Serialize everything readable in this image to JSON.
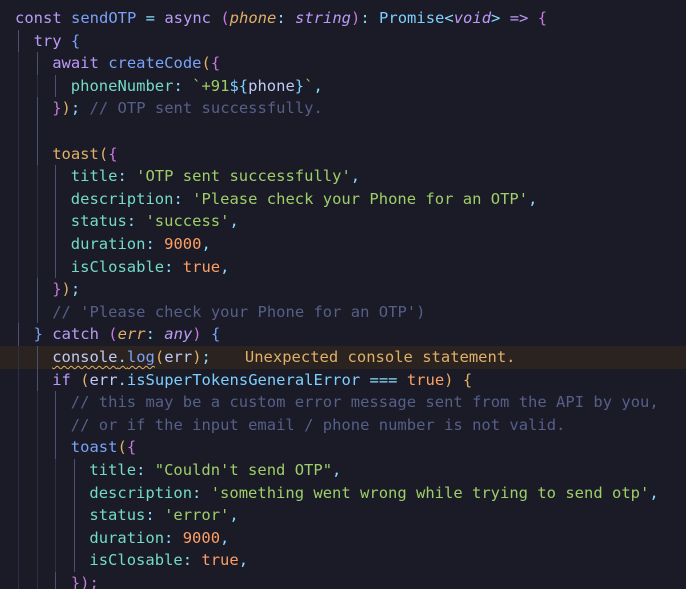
{
  "editor": {
    "lines": [
      {
        "indent": 0,
        "tokens": [
          {
            "t": "const ",
            "c": "#bb9af7"
          },
          {
            "t": "sendOTP",
            "c": "#7aa2f7"
          },
          {
            "t": " = ",
            "c": "#89ddff"
          },
          {
            "t": "async ",
            "c": "#bb9af7"
          },
          {
            "t": "(",
            "c": "#c678dd"
          },
          {
            "t": "phone",
            "c": "#e0af68",
            "i": true
          },
          {
            "t": ": ",
            "c": "#89ddff"
          },
          {
            "t": "string",
            "c": "#bb9af7",
            "i": true
          },
          {
            "t": ")",
            "c": "#c678dd"
          },
          {
            "t": ": ",
            "c": "#89ddff"
          },
          {
            "t": "Promise",
            "c": "#7dcfff"
          },
          {
            "t": "<",
            "c": "#89ddff"
          },
          {
            "t": "void",
            "c": "#bb9af7",
            "i": true
          },
          {
            "t": ">",
            "c": "#89ddff"
          },
          {
            "t": " => ",
            "c": "#bb9af7"
          },
          {
            "t": "{",
            "c": "#c678dd"
          }
        ]
      },
      {
        "indent": 1,
        "tokens": [
          {
            "t": "try ",
            "c": "#bb9af7"
          },
          {
            "t": "{",
            "c": "#7aa2f7"
          }
        ]
      },
      {
        "indent": 2,
        "tokens": [
          {
            "t": "await ",
            "c": "#bb9af7"
          },
          {
            "t": "createCode",
            "c": "#7aa2f7"
          },
          {
            "t": "(",
            "c": "#e0af68"
          },
          {
            "t": "{",
            "c": "#c678dd"
          }
        ]
      },
      {
        "indent": 3,
        "tokens": [
          {
            "t": "phoneNumber",
            "c": "#73daca"
          },
          {
            "t": ": ",
            "c": "#89ddff"
          },
          {
            "t": "`+91",
            "c": "#9ece6a"
          },
          {
            "t": "${",
            "c": "#7dcfff"
          },
          {
            "t": "phone",
            "c": "#c0caf5"
          },
          {
            "t": "}",
            "c": "#7dcfff"
          },
          {
            "t": "`",
            "c": "#9ece6a"
          },
          {
            "t": ",",
            "c": "#89ddff"
          }
        ]
      },
      {
        "indent": 2,
        "tokens": [
          {
            "t": "}",
            "c": "#c678dd"
          },
          {
            "t": ")",
            "c": "#e0af68"
          },
          {
            "t": "; ",
            "c": "#89ddff"
          },
          {
            "t": "// OTP sent successfully.",
            "c": "#565f89"
          }
        ]
      },
      {
        "indent": 2,
        "tokens": []
      },
      {
        "indent": 2,
        "tokens": [
          {
            "t": "toast",
            "c": "#e0af68"
          },
          {
            "t": "(",
            "c": "#e0af68"
          },
          {
            "t": "{",
            "c": "#c678dd"
          }
        ]
      },
      {
        "indent": 3,
        "tokens": [
          {
            "t": "title",
            "c": "#73daca"
          },
          {
            "t": ": ",
            "c": "#89ddff"
          },
          {
            "t": "'OTP sent successfully'",
            "c": "#9ece6a"
          },
          {
            "t": ",",
            "c": "#89ddff"
          }
        ]
      },
      {
        "indent": 3,
        "tokens": [
          {
            "t": "description",
            "c": "#73daca"
          },
          {
            "t": ": ",
            "c": "#89ddff"
          },
          {
            "t": "'Please check your Phone for an OTP'",
            "c": "#9ece6a"
          },
          {
            "t": ",",
            "c": "#89ddff"
          }
        ]
      },
      {
        "indent": 3,
        "tokens": [
          {
            "t": "status",
            "c": "#73daca"
          },
          {
            "t": ": ",
            "c": "#89ddff"
          },
          {
            "t": "'success'",
            "c": "#9ece6a"
          },
          {
            "t": ",",
            "c": "#89ddff"
          }
        ]
      },
      {
        "indent": 3,
        "tokens": [
          {
            "t": "duration",
            "c": "#73daca"
          },
          {
            "t": ": ",
            "c": "#89ddff"
          },
          {
            "t": "9000",
            "c": "#ff9e64"
          },
          {
            "t": ",",
            "c": "#89ddff"
          }
        ]
      },
      {
        "indent": 3,
        "tokens": [
          {
            "t": "isClosable",
            "c": "#73daca"
          },
          {
            "t": ": ",
            "c": "#89ddff"
          },
          {
            "t": "true",
            "c": "#ff9e64"
          },
          {
            "t": ",",
            "c": "#89ddff"
          }
        ]
      },
      {
        "indent": 2,
        "tokens": [
          {
            "t": "}",
            "c": "#c678dd"
          },
          {
            "t": ")",
            "c": "#e0af68"
          },
          {
            "t": ";",
            "c": "#89ddff"
          }
        ]
      },
      {
        "indent": 2,
        "tokens": [
          {
            "t": "// 'Please check your Phone for an OTP')",
            "c": "#565f89"
          }
        ]
      },
      {
        "indent": 1,
        "tokens": [
          {
            "t": "} ",
            "c": "#7aa2f7"
          },
          {
            "t": "catch ",
            "c": "#bb9af7"
          },
          {
            "t": "(",
            "c": "#c678dd"
          },
          {
            "t": "err",
            "c": "#e0af68",
            "i": true
          },
          {
            "t": ": ",
            "c": "#89ddff"
          },
          {
            "t": "any",
            "c": "#bb9af7",
            "i": true
          },
          {
            "t": ") ",
            "c": "#c678dd"
          },
          {
            "t": "{",
            "c": "#7aa2f7"
          }
        ]
      },
      {
        "indent": 2,
        "highlight": true,
        "tokens": [
          {
            "t": "console",
            "c": "#c0caf5",
            "s": true
          },
          {
            "t": ".",
            "c": "#89ddff",
            "s": true
          },
          {
            "t": "log",
            "c": "#7aa2f7",
            "s": true
          },
          {
            "t": "(",
            "c": "#e0af68"
          },
          {
            "t": "err",
            "c": "#c0caf5"
          },
          {
            "t": ")",
            "c": "#e0af68"
          },
          {
            "t": ";",
            "c": "#89ddff"
          }
        ],
        "lint": "Unexpected console statement.",
        "lint_color": "#e0af68"
      },
      {
        "indent": 2,
        "tokens": [
          {
            "t": "if ",
            "c": "#bb9af7"
          },
          {
            "t": "(",
            "c": "#e0af68"
          },
          {
            "t": "err",
            "c": "#c0caf5"
          },
          {
            "t": ".",
            "c": "#89ddff"
          },
          {
            "t": "isSuperTokensGeneralError",
            "c": "#7dcfff"
          },
          {
            "t": " === ",
            "c": "#89ddff"
          },
          {
            "t": "true",
            "c": "#ff9e64"
          },
          {
            "t": ") ",
            "c": "#e0af68"
          },
          {
            "t": "{",
            "c": "#e0af68"
          }
        ]
      },
      {
        "indent": 3,
        "tokens": [
          {
            "t": "// this may be a custom error message sent from the API by you,",
            "c": "#565f89"
          }
        ]
      },
      {
        "indent": 3,
        "tokens": [
          {
            "t": "// or if the input email / phone number is not valid.",
            "c": "#565f89"
          }
        ]
      },
      {
        "indent": 3,
        "tokens": [
          {
            "t": "toast",
            "c": "#7aa2f7"
          },
          {
            "t": "(",
            "c": "#e0af68"
          },
          {
            "t": "{",
            "c": "#c678dd"
          }
        ]
      },
      {
        "indent": 4,
        "tokens": [
          {
            "t": "title",
            "c": "#73daca"
          },
          {
            "t": ": ",
            "c": "#89ddff"
          },
          {
            "t": "\"Couldn't send OTP\"",
            "c": "#9ece6a"
          },
          {
            "t": ",",
            "c": "#89ddff"
          }
        ]
      },
      {
        "indent": 4,
        "tokens": [
          {
            "t": "description",
            "c": "#73daca"
          },
          {
            "t": ": ",
            "c": "#89ddff"
          },
          {
            "t": "'something went wrong while trying to send otp'",
            "c": "#9ece6a"
          },
          {
            "t": ",",
            "c": "#89ddff"
          }
        ]
      },
      {
        "indent": 4,
        "tokens": [
          {
            "t": "status",
            "c": "#73daca"
          },
          {
            "t": ": ",
            "c": "#89ddff"
          },
          {
            "t": "'error'",
            "c": "#9ece6a"
          },
          {
            "t": ",",
            "c": "#89ddff"
          }
        ]
      },
      {
        "indent": 4,
        "tokens": [
          {
            "t": "duration",
            "c": "#73daca"
          },
          {
            "t": ": ",
            "c": "#89ddff"
          },
          {
            "t": "9000",
            "c": "#ff9e64"
          },
          {
            "t": ",",
            "c": "#89ddff"
          }
        ]
      },
      {
        "indent": 4,
        "tokens": [
          {
            "t": "isClosable",
            "c": "#73daca"
          },
          {
            "t": ": ",
            "c": "#89ddff"
          },
          {
            "t": "true",
            "c": "#ff9e64"
          },
          {
            "t": ",",
            "c": "#89ddff"
          }
        ]
      },
      {
        "indent": 3,
        "tokens": [
          {
            "t": "});",
            "c": "#c678dd"
          }
        ]
      }
    ]
  }
}
